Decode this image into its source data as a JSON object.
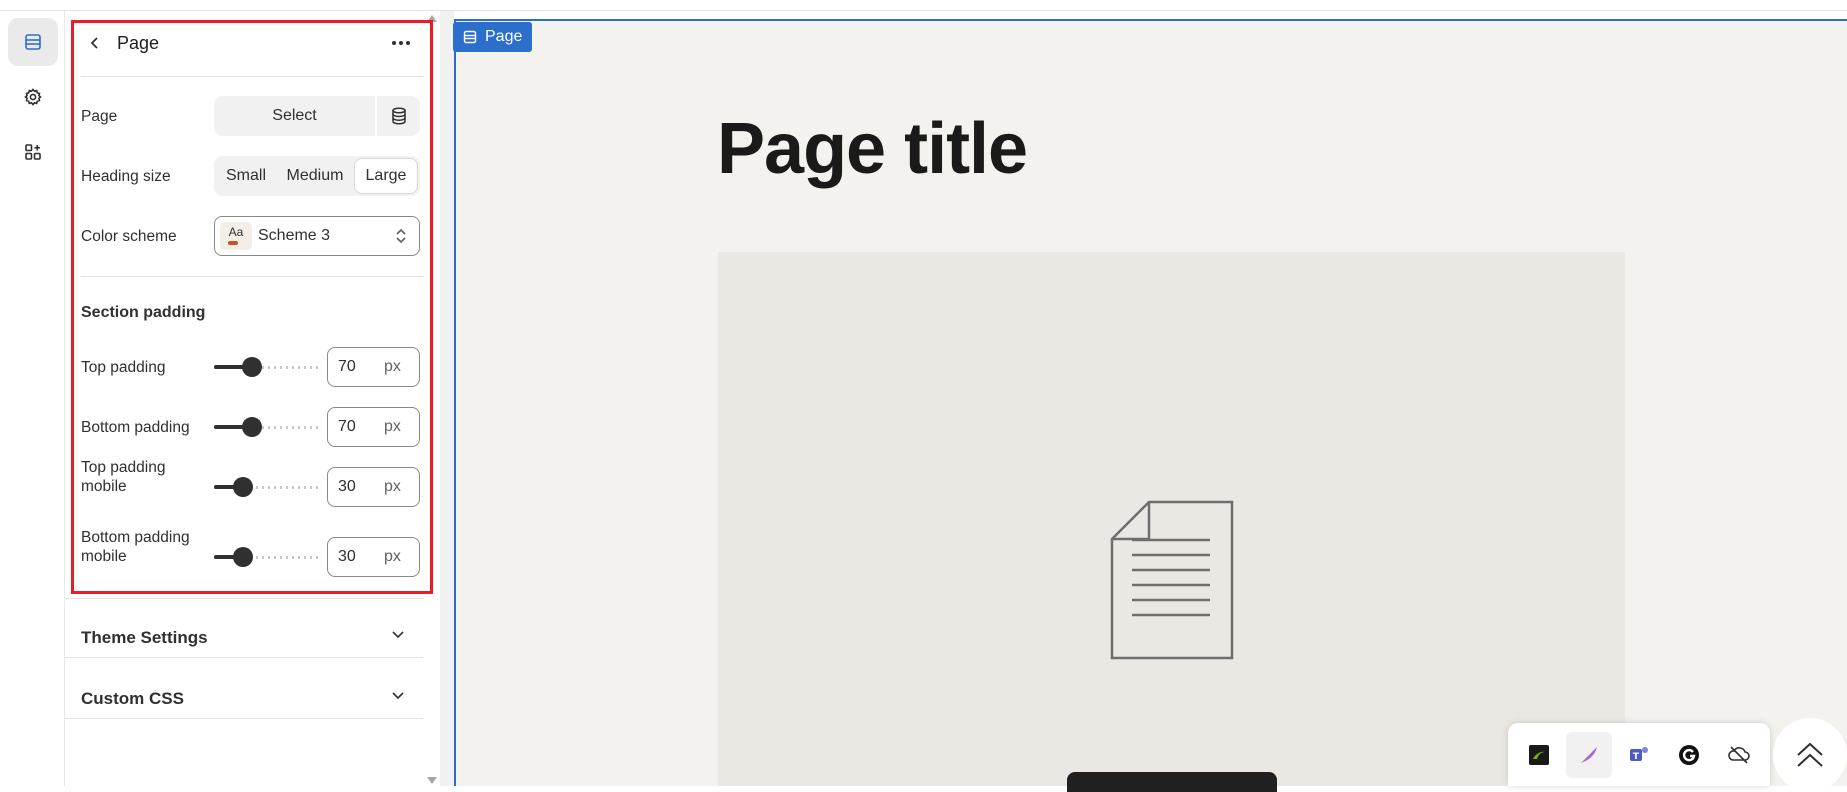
{
  "panel": {
    "title": "Page",
    "page_label": "Page",
    "select_label": "Select",
    "heading_size_label": "Heading size",
    "heading_sizes": [
      "Small",
      "Medium",
      "Large"
    ],
    "heading_size_selected": "Large",
    "color_scheme_label": "Color scheme",
    "color_scheme_swatch_text": "Aa",
    "color_scheme_value": "Scheme 3",
    "section_padding_title": "Section padding",
    "paddings": [
      {
        "label": "Top padding",
        "value": "70",
        "unit": "px",
        "fraction": 0.37
      },
      {
        "label": "Bottom padding",
        "value": "70",
        "unit": "px",
        "fraction": 0.37
      },
      {
        "label": "Top padding mobile",
        "value": "30",
        "unit": "px",
        "fraction": 0.28
      },
      {
        "label": "Bottom padding mobile",
        "value": "30",
        "unit": "px",
        "fraction": 0.28
      }
    ],
    "accordions": [
      "Theme Settings",
      "Custom CSS"
    ]
  },
  "preview": {
    "tag_label": "Page",
    "page_title": "Page title"
  },
  "colors": {
    "accent": "#2c6ecb",
    "highlight": "#ec1c24",
    "preview_bg": "#f4f2ee"
  }
}
